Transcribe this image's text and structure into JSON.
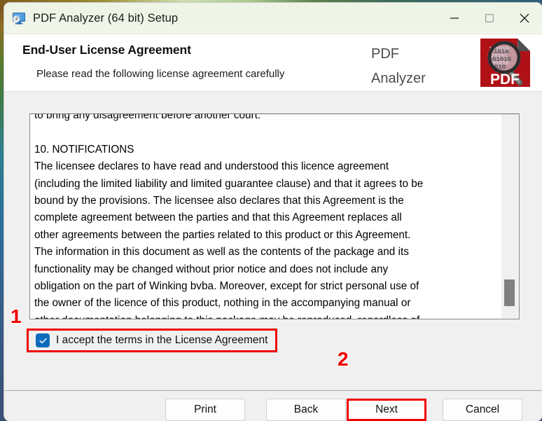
{
  "window": {
    "title": "PDF Analyzer (64 bit) Setup",
    "app_icon": "monitor-disc-icon",
    "controls": {
      "minimize": "minimize-icon",
      "maximize": "maximize-icon",
      "close": "close-icon"
    }
  },
  "banner": {
    "heading": "End-User License Agreement",
    "subheading": "Please read the following license agreement carefully",
    "brand_line1": "PDF",
    "brand_line2": "Analyzer",
    "logo": "pdf-magnifier-logo",
    "logo_label": "PDF"
  },
  "eula": {
    "text": "to bring any disagreement before another court.\n\n10. NOTIFICATIONS\nThe licensee declares to have read and understood this licence agreement\n(including the limited liability and limited guarantee clause) and that it agrees to be\nbound by the provisions. The licensee also declares that this Agreement is the\ncomplete agreement between the parties and that this Agreement replaces all\nother agreements between the parties related to this product or this Agreement.\nThe information in this document as well as the contents of the package and its\nfunctionality may be changed without prior notice and does not include any\nobligation on the part of Winking bvba. Moreover, except for strict personal use of\nthe owner of the licence of this product, nothing in the accompanying manual or\nother documentation belonging to this package may be reproduced, regardless of\nthe manner of reproduction, without prior written permission from Winking bvba.",
    "scrollbar_position": "near-bottom"
  },
  "accept": {
    "label": "I accept the terms in the License Agreement",
    "checked": true,
    "checkmark": "check-icon"
  },
  "footer": {
    "print_label": "Print",
    "back_label": "Back",
    "next_label": "Next",
    "cancel_label": "Cancel"
  },
  "annotations": {
    "step1": "1",
    "step2": "2",
    "color": "#ef0000"
  },
  "colors": {
    "accent_checkbox": "#0f6cbd",
    "annotation_red": "#ef0000",
    "logo_red": "#b01116",
    "titlebar": "#eef4e6",
    "body": "#f0f0f0"
  }
}
